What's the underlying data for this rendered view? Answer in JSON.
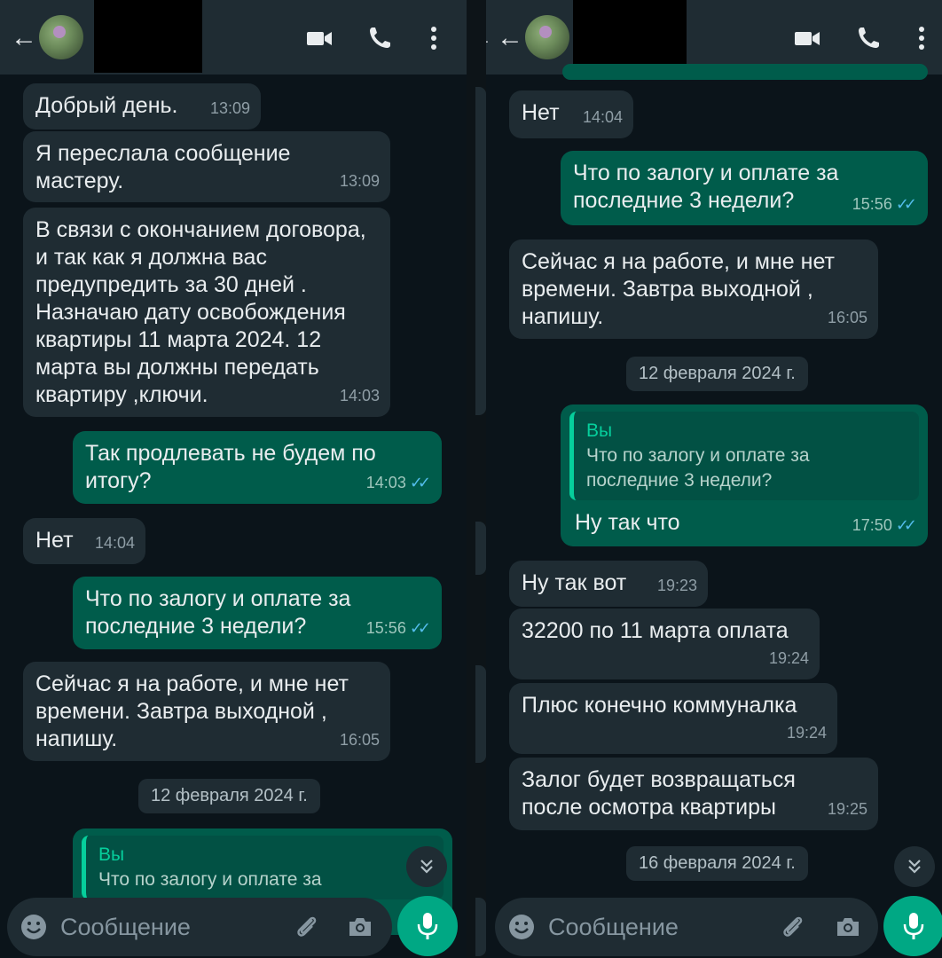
{
  "left": {
    "messages": [
      {
        "text": "Добрый день.",
        "time": "13:09"
      },
      {
        "text": "Я переслала сообщение мастеру.",
        "time": "13:09"
      },
      {
        "text": "В связи с окончанием договора, и так как я должна вас предупредить за  30 дней . Назначаю дату  освобождения квартиры 11 марта  2024. 12 марта вы должны передать квартиру ,ключи.",
        "time": "14:03"
      },
      {
        "text": "Так продлевать не будем по итогу?",
        "time": "14:03"
      },
      {
        "text": "Нет",
        "time": "14:04"
      },
      {
        "text": "Что по залогу и оплате за последние 3 недели?",
        "time": "15:56"
      },
      {
        "text": "Сейчас я на работе,  и мне нет времени. Завтра выходной , напишу.",
        "time": "16:05"
      }
    ],
    "date": "12 февраля 2024 г.",
    "quote": {
      "who": "Вы",
      "text": "Что по залогу и оплате за"
    }
  },
  "right": {
    "messages": [
      {
        "text": "Нет",
        "time": "14:04"
      },
      {
        "text": "Что по залогу и оплате за последние 3 недели?",
        "time": "15:56"
      },
      {
        "text": "Сейчас я на работе,  и мне нет времени. Завтра выходной , напишу.",
        "time": "16:05"
      },
      {
        "text": "Ну так что",
        "time": "17:50"
      },
      {
        "text": "Ну так вот",
        "time": "19:23"
      },
      {
        "text": "32200 по 11 марта оплата",
        "time": "19:24"
      },
      {
        "text": "Плюс конечно коммуналка",
        "time": "19:24"
      },
      {
        "text": "Залог будет возвращаться после осмотра квартиры",
        "time": "19:25"
      }
    ],
    "date1": "12 февраля 2024 г.",
    "date2": "16 февраля 2024 г.",
    "quote": {
      "who": "Вы",
      "text": "Что по залогу и оплате за последние 3 недели?"
    }
  },
  "input": {
    "placeholder": "Сообщение"
  },
  "icons": {
    "back": "arrow-back-icon",
    "video": "video-call-icon",
    "call": "phone-icon",
    "menu": "more-vertical-icon",
    "emoji": "emoji-icon",
    "attach": "paperclip-icon",
    "camera": "camera-icon",
    "mic": "microphone-icon",
    "scroll": "chevron-double-down-icon",
    "read": "double-check-icon"
  },
  "colors": {
    "incoming": "#1f2c33",
    "outgoing": "#005c4b",
    "accent": "#00a884",
    "read_ticks": "#53bdeb"
  }
}
